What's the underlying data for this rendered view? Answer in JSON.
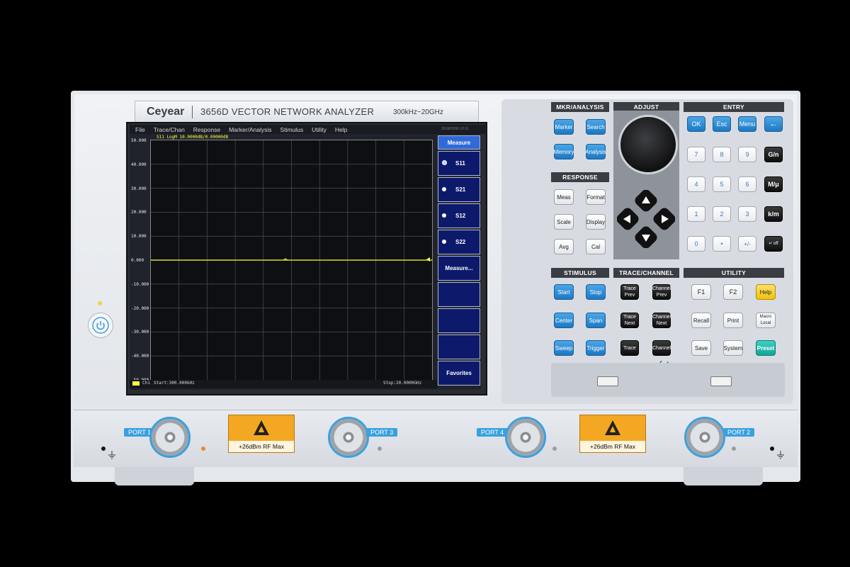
{
  "brand": {
    "logo": "Ceyear",
    "model": "3656D VECTOR NETWORK ANALYZER",
    "range": "300kHz~20GHz"
  },
  "screen": {
    "menu": [
      "File",
      "Trace/Chan",
      "Response",
      "Marker/Analysis",
      "Stimulus",
      "Utility",
      "Help"
    ],
    "timestamp": "2018/03/06 10:11",
    "trace_label": "S11 LogM 10.0000dB/0.00000dB",
    "y_ticks": [
      "50.000",
      "40.000",
      "30.000",
      "20.000",
      "10.000",
      "0.000",
      "-10.000",
      "-20.000",
      "-30.000",
      "-40.000",
      "-50.000"
    ],
    "footer_left": "Ch1",
    "start": "Start:300.000kHz",
    "stop": "Stop:20.0000GHz",
    "softmenu": {
      "header": "Measure",
      "items": [
        "S11",
        "S21",
        "S12",
        "S22",
        "Measure...",
        "",
        "",
        "",
        "Favorites"
      ]
    }
  },
  "panel": {
    "mkr_title": "MKR/ANALYSIS",
    "marker": "Marker",
    "search": "Search",
    "memory": "Memory",
    "analysis": "Analysis",
    "adjust_title": "ADJUST",
    "response_title": "RESPONSE",
    "meas": "Meas",
    "format": "Format",
    "scale": "Scale",
    "display": "Display",
    "avg": "Avg",
    "cal": "Cal",
    "entry_title": "ENTRY",
    "ok": "OK",
    "esc": "Esc",
    "menu": "Menu",
    "back": "←",
    "n7": "7",
    "n8": "8",
    "n9": "9",
    "gn": "G/n",
    "n4": "4",
    "n5": "5",
    "n6": "6",
    "mu": "M/μ",
    "n1": "1",
    "n2": "2",
    "n3": "3",
    "km": "k/m",
    "n0": "0",
    "dot": "•",
    "pm": "+/-",
    "enter": "↵ off",
    "stimulus_title": "STIMULUS",
    "start": "Start",
    "stop": "Stop",
    "center": "Center",
    "span": "Span",
    "sweep": "Sweep",
    "trigger": "Trigger",
    "trace_title": "TRACE/CHANNEL",
    "trace_prev": "Trace Prev",
    "channel_prev": "Channel Prev",
    "trace_next": "Trace Next",
    "channel_next": "Channel Next",
    "trace": "Trace",
    "channel": "Channel",
    "utility_title": "UTILITY",
    "f1": "F1",
    "f2": "F2",
    "help": "Help",
    "recall": "Recall",
    "print": "Print",
    "macro": "Macro Local",
    "save": "Save",
    "system": "System",
    "preset": "Preset"
  },
  "ports": {
    "p1": "PORT 1",
    "p3": "PORT 3",
    "p4": "PORT 4",
    "p2": "PORT 2",
    "warning": "+26dBm RF  Max"
  },
  "colors": {
    "accent_blue": "#3aa0de",
    "trace": "#ffff40",
    "softkey_bg": "#0d1a6b",
    "preset": "#11a795",
    "help": "#f1c20a"
  },
  "icons": [
    "power-icon",
    "knob-icon",
    "arrow-up-icon",
    "arrow-down-icon",
    "arrow-left-icon",
    "arrow-right-icon",
    "usb-icon",
    "esd-warning-icon",
    "ground-icon",
    "backspace-icon"
  ]
}
